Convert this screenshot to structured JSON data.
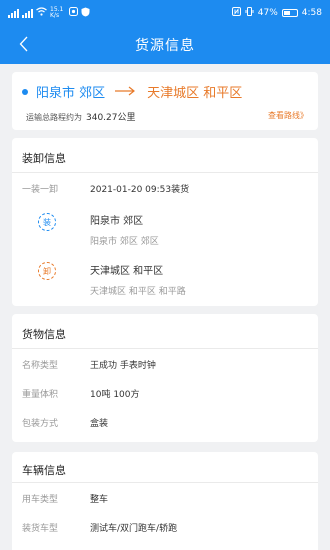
{
  "status": {
    "left_small": "15.1 K/s",
    "battery": "47%",
    "time": "4:58"
  },
  "header": {
    "title": "货源信息"
  },
  "route": {
    "from": "阳泉市 郊区",
    "to": "天津城区 和平区",
    "distance_label": "运输总路程约为",
    "distance_value": "340.27公里",
    "view_route": "查看路线》"
  },
  "load_info": {
    "title": "装卸信息",
    "mode": "一装一卸",
    "datetime": "2021-01-20 09:53装货",
    "load_badge": "装",
    "load_city": "阳泉市 郊区",
    "load_addr": "阳泉市 郊区 郊区",
    "unload_badge": "卸",
    "unload_city": "天津城区 和平区",
    "unload_addr": "天津城区 和平区 和平路"
  },
  "goods": {
    "title": "货物信息",
    "rows": [
      {
        "label": "名称类型",
        "value": "王成功 手表时钟"
      },
      {
        "label": "重量体积",
        "value": "10吨 100方"
      },
      {
        "label": "包装方式",
        "value": "盒装"
      }
    ]
  },
  "vehicle": {
    "title": "车辆信息",
    "rows": [
      {
        "label": "用车类型",
        "value": "整车"
      },
      {
        "label": "装货车型",
        "value": "测试车/双门跑车/轿跑"
      }
    ]
  },
  "colors": {
    "primary": "#1d8bf0",
    "accent": "#e87a2a"
  }
}
